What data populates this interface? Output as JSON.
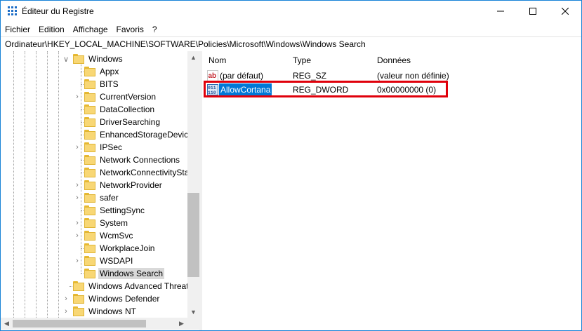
{
  "window": {
    "title": "Éditeur du Registre"
  },
  "menu": [
    "Fichier",
    "Edition",
    "Affichage",
    "Favoris",
    "?"
  ],
  "address": "Ordinateur\\HKEY_LOCAL_MACHINE\\SOFTWARE\\Policies\\Microsoft\\Windows\\Windows Search",
  "tree": {
    "parent": "Windows",
    "children": [
      "Appx",
      "BITS",
      "CurrentVersion",
      "DataCollection",
      "DriverSearching",
      "EnhancedStorageDevices",
      "IPSec",
      "Network Connections",
      "NetworkConnectivityStatusIndicator",
      "NetworkProvider",
      "safer",
      "SettingSync",
      "System",
      "WcmSvc",
      "WorkplaceJoin",
      "WSDAPI",
      "Windows Search"
    ],
    "siblings": [
      "Windows Advanced Threat Protection",
      "Windows Defender",
      "Windows NT"
    ]
  },
  "columns": {
    "name": "Nom",
    "type": "Type",
    "data": "Données"
  },
  "values": [
    {
      "name": "(par défaut)",
      "type": "REG_SZ",
      "data": "(valeur non définie)",
      "icon": "string-value-icon"
    },
    {
      "name": "AllowCortana",
      "type": "REG_DWORD",
      "data": "0x00000000 (0)",
      "icon": "dword-value-icon"
    }
  ],
  "icons": {
    "string_icon_text": "ab",
    "dword_icon_text": "011\n110"
  },
  "colors": {
    "selection": "#0078d7",
    "highlight_box": "#e0000b",
    "folder": "#f8d775",
    "title_border": "#1883d7"
  }
}
